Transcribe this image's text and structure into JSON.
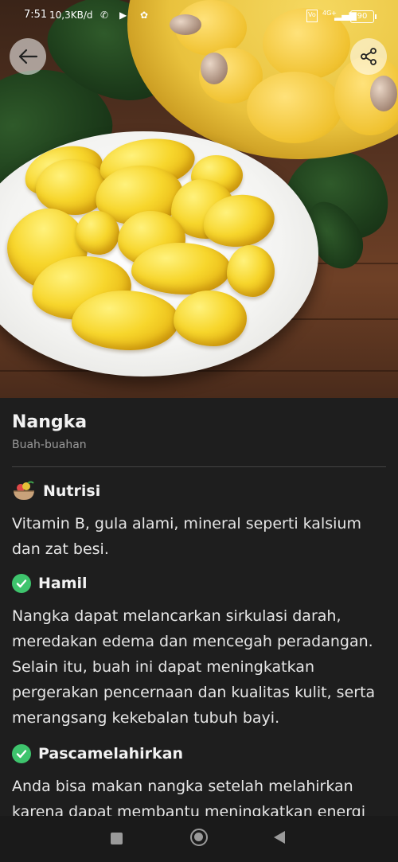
{
  "status_bar": {
    "time": "7:51",
    "speed": "10,3KB/d",
    "network": "4G+",
    "battery": "90"
  },
  "header": {
    "back_icon": "arrow-left-icon",
    "share_icon": "share-icon"
  },
  "fruit": {
    "title": "Nangka",
    "category": "Buah-buahan"
  },
  "sections": [
    {
      "icon": "nutrition-bowl-icon",
      "label": "Nutrisi",
      "text": "Vitamin B, gula alami, mineral seperti kalsium dan zat besi."
    },
    {
      "icon": "check-circle-icon",
      "label": "Hamil",
      "text": "Nangka dapat melancarkan sirkulasi darah, meredakan edema dan mencegah peradangan. Selain itu, buah ini dapat meningkatkan pergerakan pencernaan dan kualitas kulit, serta merangsang kekebalan tubuh bayi."
    },
    {
      "icon": "check-circle-icon",
      "label": "Pascamelahirkan",
      "text": "Anda bisa makan nangka setelah melahirkan karena dapat membantu meningkatkan energi"
    }
  ],
  "colors": {
    "background": "#1e1e1e",
    "check_green": "#3ec46d",
    "text_primary": "#f2f2f2",
    "text_secondary": "#9a9a9a"
  }
}
